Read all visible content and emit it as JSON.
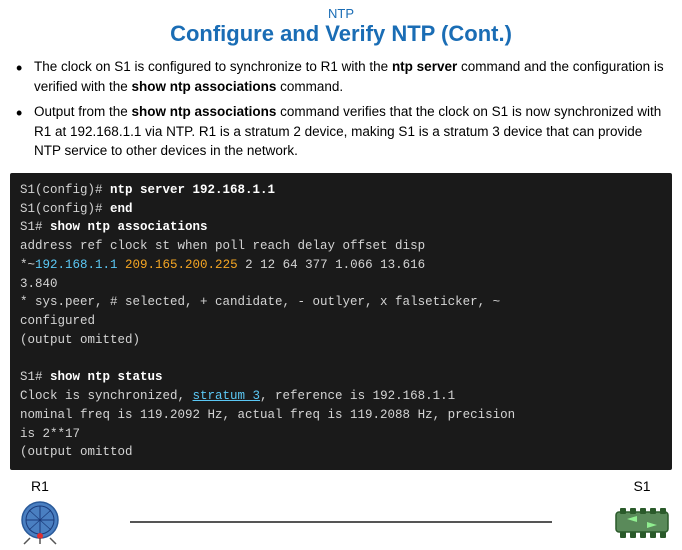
{
  "header": {
    "subtitle": "NTP",
    "title": "Configure and Verify NTP (Cont.)"
  },
  "bullets": [
    {
      "text_before": "The clock on S1 is configured to synchronize to R1 with the ",
      "bold": "ntp server",
      "text_after": " command and the configuration is verified with the ",
      "bold2": "show ntp associations",
      "text_after2": " command."
    },
    {
      "text_before": "Output from the ",
      "bold": "show ntp associations",
      "text_after": " command verifies that the clock on S1 is now synchronized with R1 at 192.168.1.1 via NTP. R1 is a stratum 2 device, making S1 is a stratum 3 device that can provide NTP service to other devices in the network."
    }
  ],
  "terminal": {
    "lines": [
      {
        "type": "command",
        "prompt": "S1(config)# ",
        "cmd": "ntp server 192.168.1.1"
      },
      {
        "type": "command",
        "prompt": "S1(config)# ",
        "cmd": "end"
      },
      {
        "type": "command",
        "prompt": "S1# ",
        "cmd": "show ntp associations"
      },
      {
        "type": "normal",
        "text": "address         ref clock       st when poll reach delay offset disp"
      },
      {
        "type": "assoc",
        "star": "*~",
        "ip1": "192.168.1.1",
        "ip2": "209.165.200.225",
        "rest": "  2  12    64    377   1.066 13.616"
      },
      {
        "type": "normal",
        "text": "3.840"
      },
      {
        "type": "note",
        "text": "* sys.peer, # selected, + candidate, - outlyer, x falseticker, ~"
      },
      {
        "type": "normal",
        "text": "  configured"
      },
      {
        "type": "normal",
        "text": "(output omitted)"
      },
      {
        "type": "blank"
      },
      {
        "type": "command",
        "prompt": "S1# ",
        "cmd": "show ntp status"
      },
      {
        "type": "status1",
        "text": "Clock is synchronized, ",
        "stratum": "stratum 3",
        "rest": ", reference is 192.168.1.1"
      },
      {
        "type": "normal",
        "text": "nominal freq is 119.2092 Hz, actual freq is 119.2088 Hz, precision"
      },
      {
        "type": "normal",
        "text": "is 2**17"
      },
      {
        "type": "normal",
        "text": "(output omittod"
      }
    ]
  },
  "diagram": {
    "r1_label": "R1",
    "s1_label": "S1"
  }
}
